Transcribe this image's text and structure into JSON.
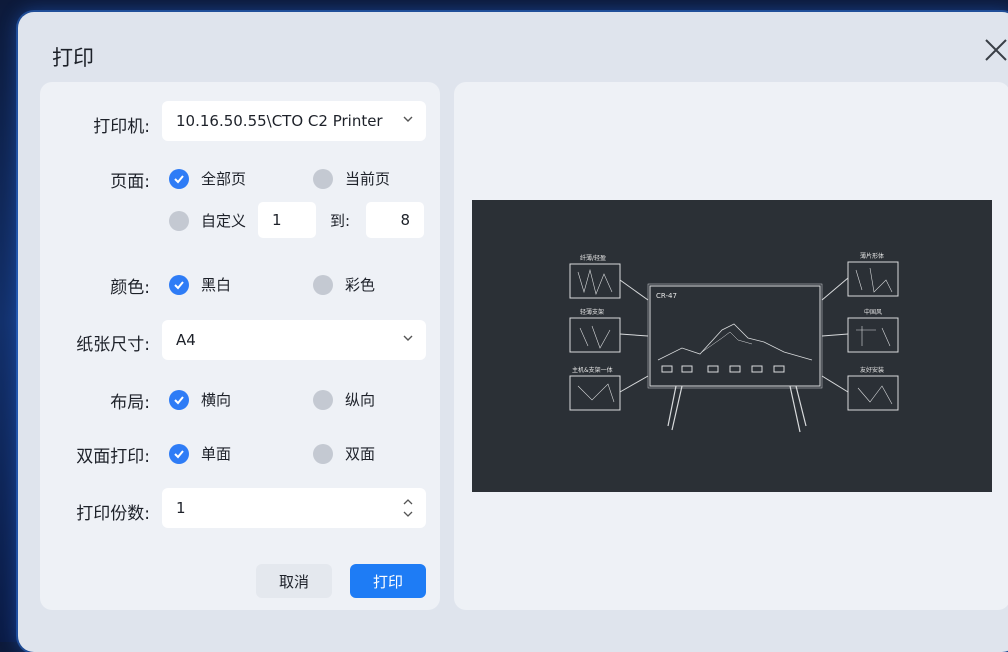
{
  "dialog": {
    "title": "打印"
  },
  "printer": {
    "label": "打印机:",
    "value": "10.16.50.55\\CTO C2 Printer"
  },
  "pages": {
    "label": "页面:",
    "all": "全部页",
    "current": "当前页",
    "custom": "自定义",
    "from": "1",
    "to_label": "到:",
    "to": "8",
    "selected": "all"
  },
  "color": {
    "label": "颜色:",
    "bw": "黑白",
    "color": "彩色",
    "selected": "bw"
  },
  "paper": {
    "label": "纸张尺寸:",
    "value": "A4"
  },
  "layout": {
    "label": "布局:",
    "landscape": "横向",
    "portrait": "纵向",
    "selected": "landscape"
  },
  "duplex": {
    "label": "双面打印:",
    "single": "单面",
    "double": "双面",
    "selected": "single"
  },
  "copies": {
    "label": "打印份数:",
    "value": "1"
  },
  "buttons": {
    "cancel": "取消",
    "print": "打印"
  },
  "preview": {
    "callouts": [
      "纤薄/轻盈",
      "轻薄支架",
      "主机&支架一体",
      "薄片形体",
      "中国风",
      "友好安装"
    ],
    "screen_brand": "CR-47"
  },
  "colors": {
    "accent": "#1e7cf5",
    "dialog_bg": "#dfe4ed",
    "panel_bg": "#eef1f6",
    "preview_bg": "#2b3036"
  }
}
